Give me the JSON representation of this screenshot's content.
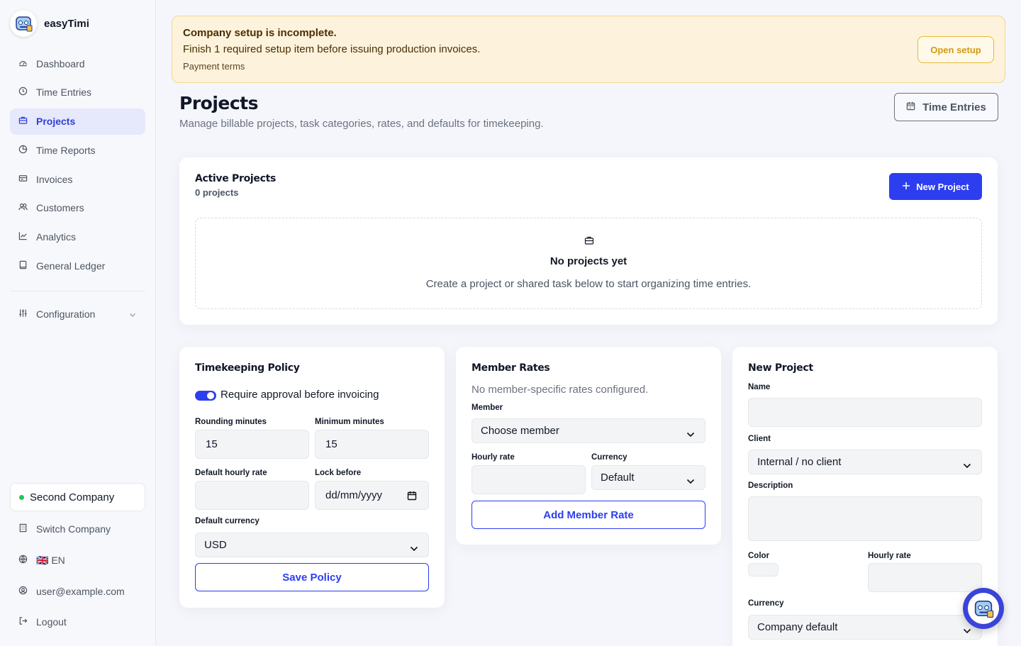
{
  "app": {
    "name": "easyTimi"
  },
  "sidebar": {
    "items": [
      {
        "label": "Dashboard",
        "icon": "dashboard-icon"
      },
      {
        "label": "Time Entries",
        "icon": "clock-icon"
      },
      {
        "label": "Projects",
        "icon": "briefcase-icon",
        "active": true
      },
      {
        "label": "Time Reports",
        "icon": "chart-pie-icon"
      },
      {
        "label": "Invoices",
        "icon": "invoice-icon"
      },
      {
        "label": "Customers",
        "icon": "users-icon"
      },
      {
        "label": "Analytics",
        "icon": "trend-icon"
      },
      {
        "label": "General Ledger",
        "icon": "book-icon"
      }
    ],
    "configuration": "Configuration",
    "company": "Second Company",
    "switch_company": "Switch Company",
    "language": "🇬🇧 EN",
    "user": "user@example.com",
    "logout": "Logout"
  },
  "banner": {
    "title": "Company setup is incomplete.",
    "text": "Finish 1 required setup item before issuing production invoices.",
    "item": "Payment terms",
    "button": "Open setup"
  },
  "header": {
    "title": "Projects",
    "subtitle": "Manage billable projects, task categories, rates, and defaults for timekeeping.",
    "time_entries_button": "Time Entries"
  },
  "active_projects": {
    "title": "Active Projects",
    "count": "0 projects",
    "new_button": "New Project",
    "empty_title": "No projects yet",
    "empty_text": "Create a project or shared task below to start organizing time entries."
  },
  "policy": {
    "title": "Timekeeping Policy",
    "toggle_label": "Require approval before invoicing",
    "toggle_on": true,
    "rounding_label": "Rounding minutes",
    "rounding_value": "15",
    "minimum_label": "Minimum minutes",
    "minimum_value": "15",
    "hourly_label": "Default hourly rate",
    "hourly_value": "",
    "lock_label": "Lock before",
    "lock_placeholder": "dd/mm/yyyy",
    "currency_label": "Default currency",
    "currency_value": "USD",
    "save_button": "Save Policy"
  },
  "member_rates": {
    "title": "Member Rates",
    "empty": "No member-specific rates configured.",
    "member_label": "Member",
    "member_value": "Choose member",
    "hourly_label": "Hourly rate",
    "hourly_value": "",
    "currency_label": "Currency",
    "currency_value": "Default",
    "add_button": "Add Member Rate"
  },
  "new_project": {
    "title": "New Project",
    "name_label": "Name",
    "name_value": "",
    "client_label": "Client",
    "client_value": "Internal / no client",
    "description_label": "Description",
    "description_value": "",
    "color_label": "Color",
    "hourly_label": "Hourly rate",
    "hourly_value": "",
    "currency_label": "Currency",
    "currency_value": "Company default"
  },
  "colors": {
    "accent": "#2d3ef0",
    "banner_bg": "#fdf3dc",
    "active_nav_bg": "#e6e8fb",
    "status_green": "#22c55e"
  }
}
